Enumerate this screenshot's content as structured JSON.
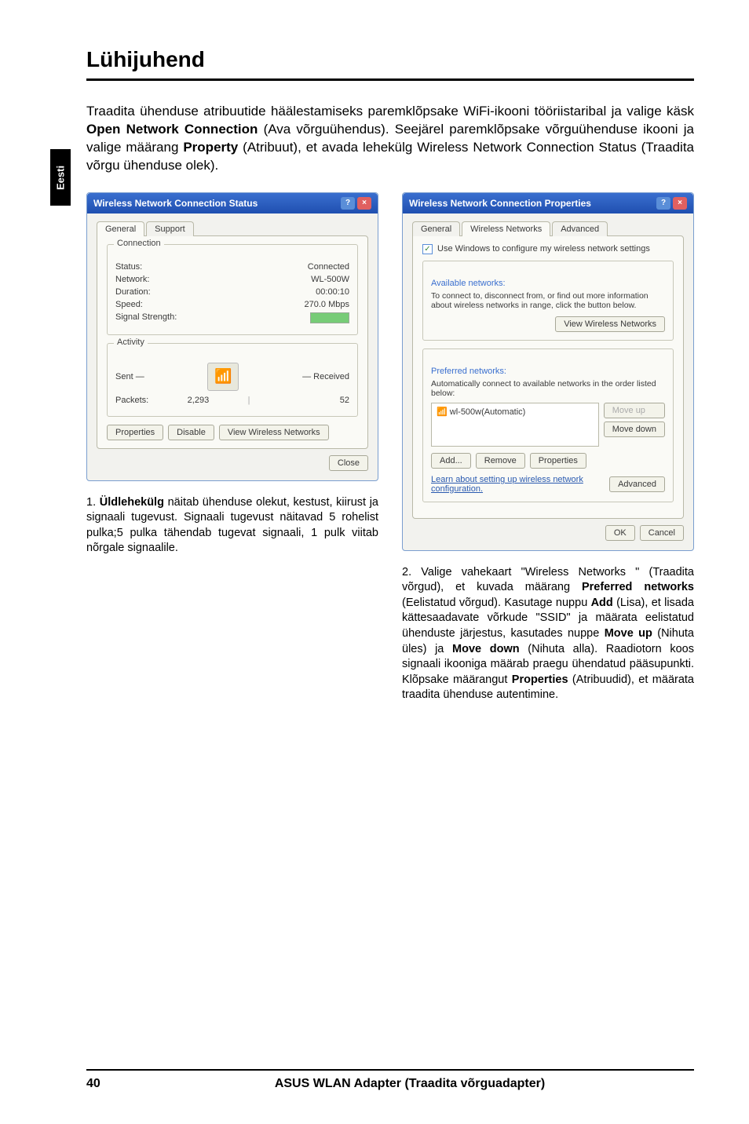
{
  "sideTab": "Eesti",
  "title": "Lühijuhend",
  "intro_segments": [
    {
      "t": "Traadita ühenduse atribuutide häälestamiseks paremklõpsake WiFi-ikooni tööriistaribal ja valige käsk ",
      "b": false
    },
    {
      "t": "Open Network Connection",
      "b": true
    },
    {
      "t": " (Ava võrguühendus). Seejärel paremklõpsake võrguühenduse ikooni ja valige määrang ",
      "b": false
    },
    {
      "t": "Property",
      "b": true
    },
    {
      "t": " (Atribuut), et avada lehekülg Wireless Network Connection Status (Traadita võrgu ühenduse olek).",
      "b": false
    }
  ],
  "win1": {
    "title": "Wireless Network Connection Status",
    "tabs": [
      "General",
      "Support"
    ],
    "group1": "Connection",
    "rows": [
      {
        "k": "Status:",
        "v": "Connected"
      },
      {
        "k": "Network:",
        "v": "WL-500W"
      },
      {
        "k": "Duration:",
        "v": "00:00:10"
      },
      {
        "k": "Speed:",
        "v": "270.0 Mbps"
      },
      {
        "k": "Signal Strength:",
        "v": ""
      }
    ],
    "group2": "Activity",
    "sent": "Sent",
    "received": "Received",
    "packetsLabel": "Packets:",
    "packetsSent": "2,293",
    "packetsRecv": "52",
    "btnProps": "Properties",
    "btnDisable": "Disable",
    "btnView": "View Wireless Networks",
    "btnClose": "Close"
  },
  "win2": {
    "title": "Wireless Network Connection Properties",
    "tabs": [
      "General",
      "Wireless Networks",
      "Advanced"
    ],
    "chk": "Use Windows to configure my wireless network settings",
    "avail": "Available networks:",
    "availDesc": "To connect to, disconnect from, or find out more information about wireless networks in range, click the button below.",
    "btnViewNets": "View Wireless Networks",
    "pref": "Preferred networks:",
    "prefDesc": "Automatically connect to available networks in the order listed below:",
    "netItem": "wl-500w(Automatic)",
    "btnMoveUp": "Move up",
    "btnMoveDown": "Move down",
    "btnAdd": "Add...",
    "btnRemove": "Remove",
    "btnProperties": "Properties",
    "learn": "Learn about setting up wireless network configuration.",
    "btnAdvanced": "Advanced",
    "btnOK": "OK",
    "btnCancel": "Cancel"
  },
  "caption1_segments": [
    {
      "t": "1. ",
      "b": false
    },
    {
      "t": "Üldlehekülg",
      "b": true
    },
    {
      "t": " näitab ühenduse olekut, kestust, kiirust ja signaali tugevust. Signaali tugevust näitavad 5 rohelist pulka;5 pulka tähendab tugevat signaali, 1 pulk viitab nõrgale signaalile.",
      "b": false
    }
  ],
  "caption2_segments": [
    {
      "t": "2. Valige vahekaart \"Wireless Networks \" (Traadita võrgud), et kuvada määrang ",
      "b": false
    },
    {
      "t": "Preferred networks",
      "b": true
    },
    {
      "t": " (Eelistatud võrgud). Kasutage nuppu ",
      "b": false
    },
    {
      "t": "Add",
      "b": true
    },
    {
      "t": " (Lisa), et lisada kättesaadavate võrkude \"SSID\" ja määrata eelistatud ühenduste järjestus, kasutades nuppe ",
      "b": false
    },
    {
      "t": "Move up",
      "b": true
    },
    {
      "t": " (Nihuta üles) ja ",
      "b": false
    },
    {
      "t": "Move down",
      "b": true
    },
    {
      "t": " (Nihuta alla). Raadiotorn koos signaali ikooniga määrab praegu ühendatud pääsupunkti. Klõpsake määrangut ",
      "b": false
    },
    {
      "t": "Properties",
      "b": true
    },
    {
      "t": " (Atribuudid), et määrata traadita ühenduse autentimine.",
      "b": false
    }
  ],
  "footer": {
    "page": "40",
    "title": "ASUS WLAN Adapter (Traadita võrguadapter)"
  }
}
